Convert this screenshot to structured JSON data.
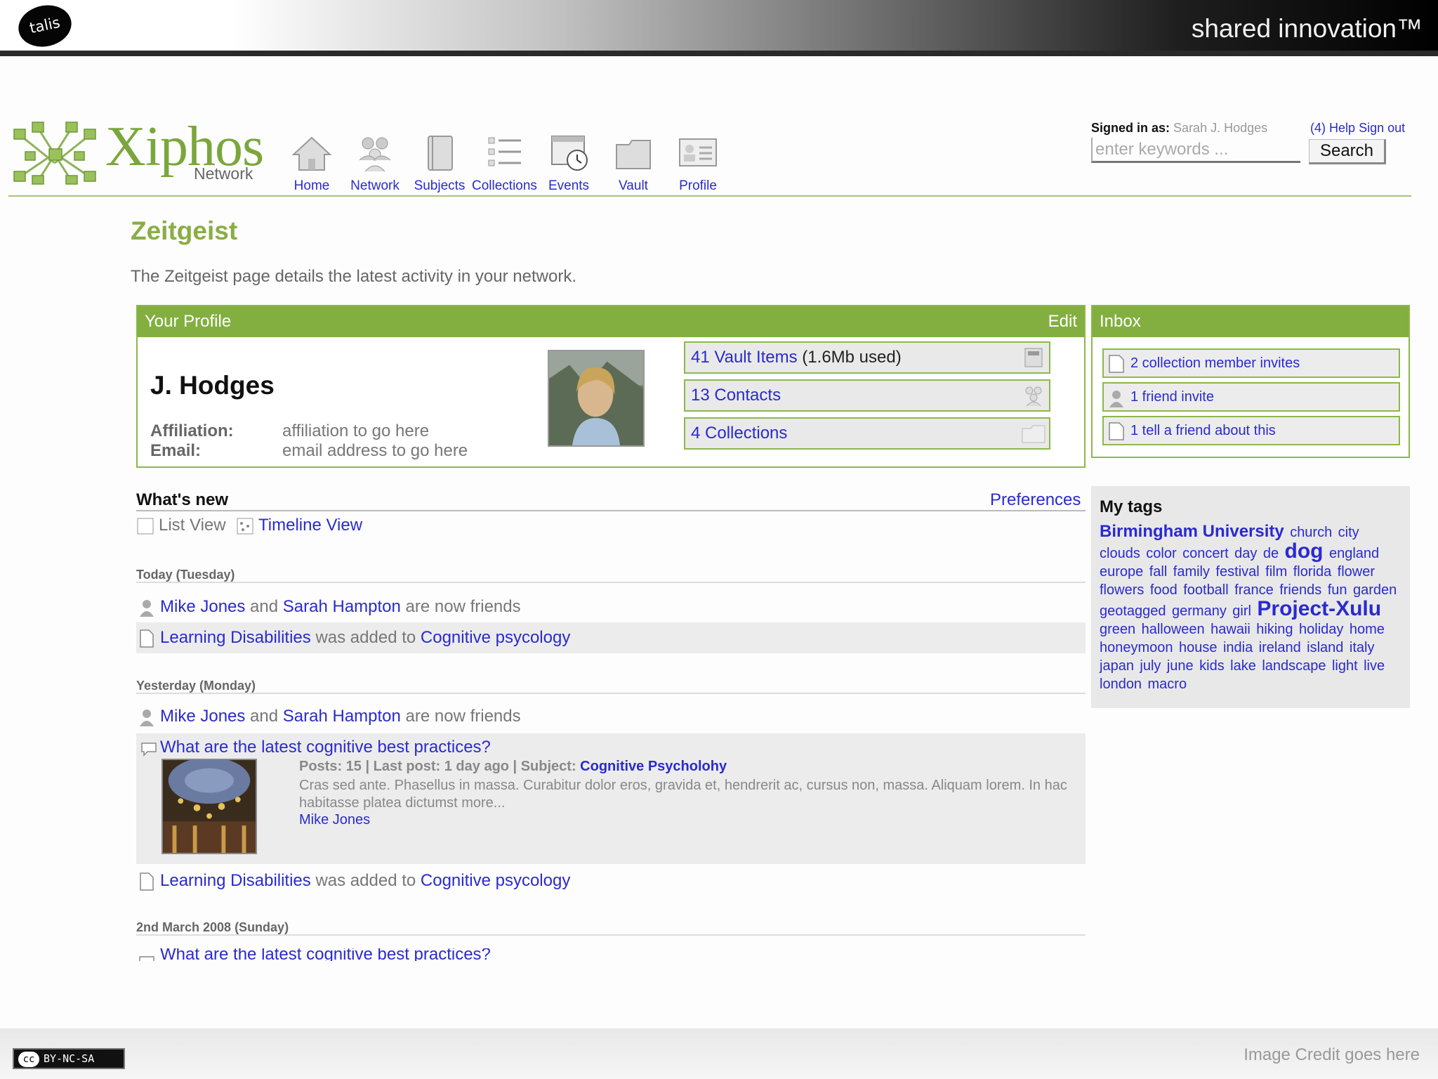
{
  "banner": {
    "logo_text": "talis",
    "tagline": "shared innovation™"
  },
  "app": {
    "logo_word": "Xiphos",
    "logo_sub": "Network"
  },
  "nav": [
    {
      "label": "Home",
      "icon": "home-icon"
    },
    {
      "label": "Network",
      "icon": "people-icon"
    },
    {
      "label": "Subjects",
      "icon": "book-icon"
    },
    {
      "label": "Collections",
      "icon": "list-icon"
    },
    {
      "label": "Events",
      "icon": "calendar-icon"
    },
    {
      "label": "Vault",
      "icon": "folder-icon"
    },
    {
      "label": "Profile",
      "icon": "profile-card-icon"
    }
  ],
  "account": {
    "signed_in_label": "Signed in as:",
    "user_name": "Sarah J. Hodges",
    "inbox_count": "(4)",
    "help": "Help",
    "sign_out": "Sign out"
  },
  "search": {
    "placeholder": "enter keywords ...",
    "button": "Search"
  },
  "page": {
    "title": "Zeitgeist",
    "description": "The Zeitgeist page details the latest activity in your network."
  },
  "profile": {
    "heading": "Your Profile",
    "edit": "Edit",
    "name": "J. Hodges",
    "affiliation_label": "Affiliation:",
    "affiliation": "affiliation to go here",
    "email_label": "Email:",
    "email": "email address to go here",
    "stats": [
      {
        "link": "41 Vault Items",
        "extra": " (1.6Mb used)",
        "icon": "vault-icon"
      },
      {
        "link": "13 Contacts",
        "extra": "",
        "icon": "contacts-icon"
      },
      {
        "link": "4 Collections",
        "extra": "",
        "icon": "folder-icon"
      }
    ]
  },
  "inbox": {
    "heading": "Inbox",
    "items": [
      {
        "label": "2 collection member invites",
        "icon": "document-icon"
      },
      {
        "label": "1 friend invite",
        "icon": "person-icon"
      },
      {
        "label": "1 tell a friend about this",
        "icon": "document-icon"
      }
    ]
  },
  "whats_new": {
    "title": "What's new",
    "preferences": "Preferences",
    "list_view": "List View",
    "timeline_view": "Timeline View",
    "days": [
      {
        "heading": "Today (Tuesday)"
      },
      {
        "heading": "Yesterday (Monday)"
      },
      {
        "heading": "2nd March 2008 (Sunday)"
      }
    ],
    "friend_activity": {
      "a": "Mike Jones",
      "and": " and ",
      "b": "Sarah Hampton",
      "rest": " are now friends"
    },
    "added_activity": {
      "item": "Learning Disabilities",
      "mid": " was added to ",
      "target": "Cognitive psycology"
    },
    "discussion": {
      "title": "What are the latest cognitive best practices?",
      "meta": "Posts: 15 | Last post: 1 day ago | Subject: ",
      "subject": "Cognitive Psycholohy",
      "body": "Cras sed ante. Phasellus in massa. Curabitur dolor eros, gravida et, hendrerit ac, cursus non, massa. Aliquam lorem. In hac habitasse platea dictumst more...",
      "author": "Mike Jones"
    },
    "partial_item": "What are the latest cognitive best practices?"
  },
  "tags": {
    "title": "My tags",
    "items": [
      {
        "t": "Birmingham University",
        "s": "big"
      },
      {
        "t": "church",
        "s": ""
      },
      {
        "t": "city",
        "s": ""
      },
      {
        "t": "clouds",
        "s": ""
      },
      {
        "t": "color",
        "s": ""
      },
      {
        "t": "concert",
        "s": ""
      },
      {
        "t": "day",
        "s": ""
      },
      {
        "t": "de",
        "s": ""
      },
      {
        "t": "dog",
        "s": "xl"
      },
      {
        "t": "england",
        "s": ""
      },
      {
        "t": "europe",
        "s": ""
      },
      {
        "t": "fall",
        "s": ""
      },
      {
        "t": "family",
        "s": ""
      },
      {
        "t": "festival",
        "s": ""
      },
      {
        "t": "film",
        "s": ""
      },
      {
        "t": "florida",
        "s": ""
      },
      {
        "t": "flower",
        "s": ""
      },
      {
        "t": "flowers",
        "s": ""
      },
      {
        "t": "food",
        "s": ""
      },
      {
        "t": "football",
        "s": ""
      },
      {
        "t": "france",
        "s": ""
      },
      {
        "t": "friends",
        "s": ""
      },
      {
        "t": "fun",
        "s": ""
      },
      {
        "t": "garden",
        "s": ""
      },
      {
        "t": "geotagged",
        "s": ""
      },
      {
        "t": "germany",
        "s": ""
      },
      {
        "t": "girl",
        "s": ""
      },
      {
        "t": "Project-Xulu",
        "s": "xl"
      },
      {
        "t": "green",
        "s": ""
      },
      {
        "t": "halloween",
        "s": ""
      },
      {
        "t": "hawaii",
        "s": ""
      },
      {
        "t": "hiking",
        "s": ""
      },
      {
        "t": "holiday",
        "s": ""
      },
      {
        "t": "home",
        "s": ""
      },
      {
        "t": "honeymoon",
        "s": ""
      },
      {
        "t": "house",
        "s": ""
      },
      {
        "t": "india",
        "s": ""
      },
      {
        "t": "ireland",
        "s": ""
      },
      {
        "t": "island",
        "s": ""
      },
      {
        "t": "italy",
        "s": ""
      },
      {
        "t": "japan",
        "s": ""
      },
      {
        "t": "july",
        "s": ""
      },
      {
        "t": "june",
        "s": ""
      },
      {
        "t": "kids",
        "s": ""
      },
      {
        "t": "lake",
        "s": ""
      },
      {
        "t": "landscape",
        "s": ""
      },
      {
        "t": "light",
        "s": ""
      },
      {
        "t": "live",
        "s": ""
      },
      {
        "t": "london",
        "s": ""
      },
      {
        "t": "macro",
        "s": ""
      }
    ]
  },
  "footer": {
    "license": "BY-NC-SA",
    "credit": "Image Credit goes here"
  },
  "colors": {
    "brand_green": "#82af3f",
    "link_blue": "#2a2ad0"
  }
}
